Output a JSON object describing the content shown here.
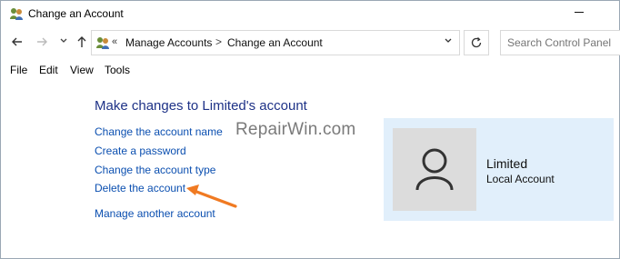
{
  "window": {
    "title": "Change an Account"
  },
  "icons": {
    "app": "users-icon",
    "back": "arrow-left-icon",
    "forward": "arrow-right-icon",
    "recent": "chevron-down-icon",
    "up": "arrow-up-icon",
    "refresh": "refresh-icon",
    "avatar": "user-silhouette-icon",
    "pointer": "orange-arrow-icon"
  },
  "address_bar": {
    "overflow": "«",
    "crumbs": [
      "Manage Accounts",
      "Change an Account"
    ],
    "separator": ">"
  },
  "search": {
    "placeholder": "Search Control Panel"
  },
  "menu": [
    "File",
    "Edit",
    "View",
    "Tools"
  ],
  "content": {
    "heading": "Make changes to Limited's account",
    "links": [
      "Change the account name",
      "Create a password",
      "Change the account type",
      "Delete the account"
    ],
    "other_link": "Manage another account"
  },
  "watermark": "RepairWin.com",
  "account": {
    "name": "Limited",
    "type": "Local Account"
  },
  "colors": {
    "link": "#0b4fb0",
    "heading": "#1e3287",
    "panel": "#e1effb",
    "arrow": "#f07a22"
  }
}
